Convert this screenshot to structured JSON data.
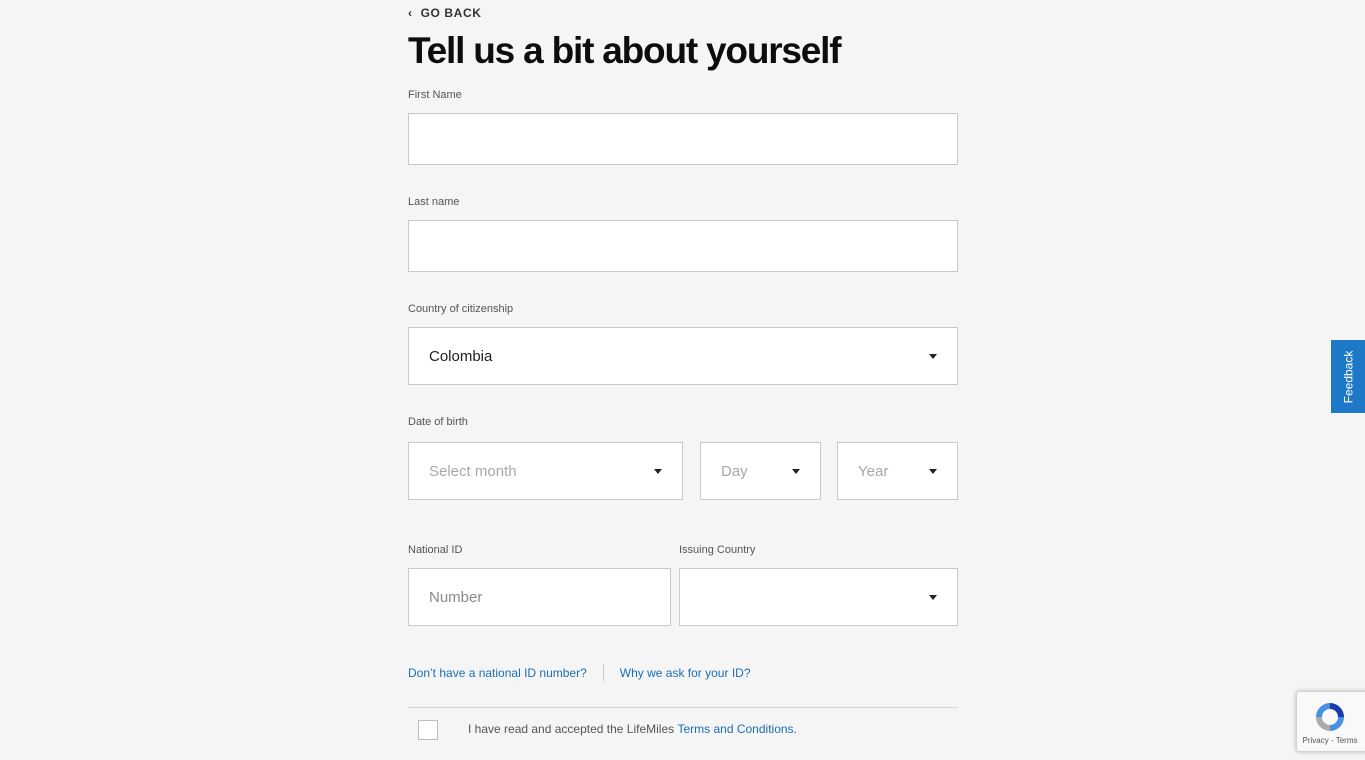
{
  "nav": {
    "go_back_label": "GO BACK"
  },
  "page": {
    "title": "Tell us a bit about yourself"
  },
  "form": {
    "first_name": {
      "label": "First Name",
      "value": "",
      "placeholder": ""
    },
    "last_name": {
      "label": "Last name",
      "value": "",
      "placeholder": ""
    },
    "citizenship": {
      "label": "Country of citizenship",
      "selected": "Colombia"
    },
    "dob": {
      "label": "Date of birth",
      "month_placeholder": "Select month",
      "day_placeholder": "Day",
      "year_placeholder": "Year"
    },
    "national_id": {
      "label": "National ID",
      "value": "",
      "placeholder": "Number"
    },
    "issuing_country": {
      "label": "Issuing Country",
      "selected": ""
    }
  },
  "links": {
    "no_id": "Don’t have a national ID number?",
    "why_id": "Why we ask for your ID?"
  },
  "terms": {
    "text": "I have read and accepted the LifeMiles ",
    "link": "Terms and Conditions",
    "suffix": ".",
    "checked": false
  },
  "feedback": {
    "label": "Feedback"
  },
  "recaptcha": {
    "links": "Privacy - Terms"
  },
  "colors": {
    "link": "#1a6fb5",
    "feedback_bg": "#1e78c8",
    "page_bg": "#f5f5f5"
  },
  "icons": [
    "chevron-left-icon",
    "caret-down-icon",
    "recaptcha-logo-icon"
  ]
}
